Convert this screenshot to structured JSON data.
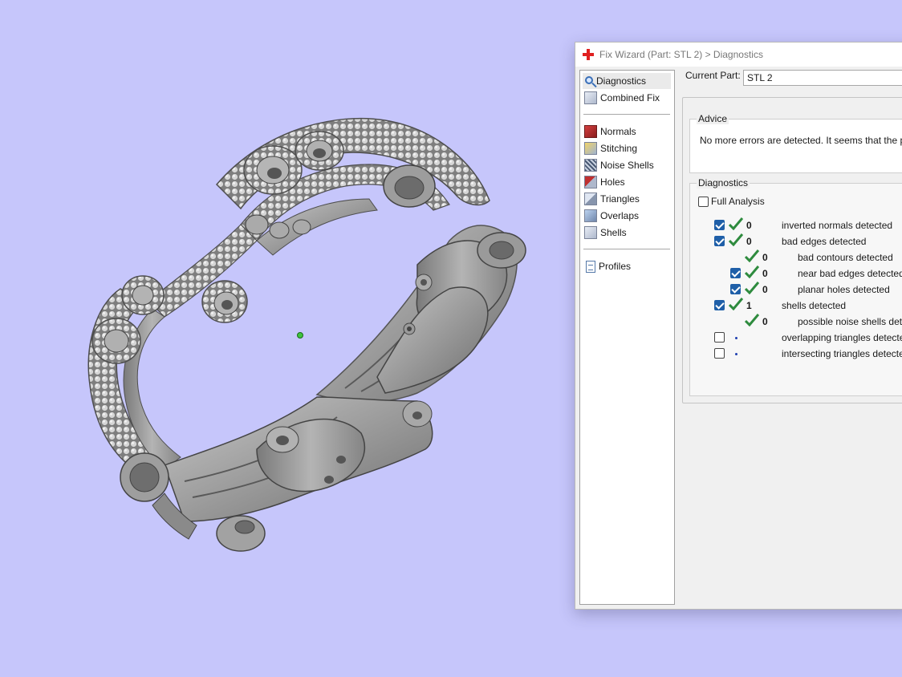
{
  "dialog": {
    "title": "Fix Wizard (Part: STL 2) > Diagnostics"
  },
  "nav": {
    "items": [
      {
        "label": "Diagnostics",
        "icon": "magnifier-icon",
        "selected": true
      },
      {
        "label": "Combined Fix",
        "icon": "cube-icon"
      },
      {
        "label": "Normals",
        "icon": "normals-cube-icon"
      },
      {
        "label": "Stitching",
        "icon": "stitching-cube-icon"
      },
      {
        "label": "Noise Shells",
        "icon": "noise-shells-cube-icon"
      },
      {
        "label": "Holes",
        "icon": "holes-cube-icon"
      },
      {
        "label": "Triangles",
        "icon": "triangles-cube-icon"
      },
      {
        "label": "Overlaps",
        "icon": "overlaps-cube-icon"
      },
      {
        "label": "Shells",
        "icon": "shells-cube-icon"
      },
      {
        "label": "Profiles",
        "icon": "document-icon"
      }
    ]
  },
  "current_part": {
    "label": "Current Part:",
    "value": "STL 2"
  },
  "advice": {
    "title": "Advice",
    "text": "No more errors are detected. It seems that the part"
  },
  "diagnostics": {
    "title": "Diagnostics",
    "full_analysis_label": "Full Analysis",
    "full_analysis_checked": false,
    "rows": [
      {
        "checked": true,
        "status": "ok",
        "value": "0",
        "label": "inverted normals detected",
        "indent": 0
      },
      {
        "checked": true,
        "status": "ok",
        "value": "0",
        "label": "bad edges detected",
        "indent": 0
      },
      {
        "checked": null,
        "status": "ok",
        "value": "0",
        "label": "bad contours detected",
        "indent": 1
      },
      {
        "checked": true,
        "status": "ok",
        "value": "0",
        "label": "near bad edges detected",
        "indent": 1
      },
      {
        "checked": true,
        "status": "ok",
        "value": "0",
        "label": "planar holes detected",
        "indent": 1
      },
      {
        "checked": true,
        "status": "ok",
        "value": "1",
        "label": "shells detected",
        "indent": 0
      },
      {
        "checked": null,
        "status": "ok",
        "value": "0",
        "label": "possible noise shells detecte",
        "indent": 1
      },
      {
        "checked": false,
        "status": "none",
        "value": "",
        "label": "overlapping triangles detected",
        "indent": 0
      },
      {
        "checked": false,
        "status": "none",
        "value": "",
        "label": "intersecting triangles detected",
        "indent": 0
      }
    ]
  },
  "colors": {
    "viewport_bg": "#c6c6fb",
    "accent": "#1f5fa8",
    "ok_green": "#2e8b3e",
    "model_gray": "#9a9a9a"
  }
}
